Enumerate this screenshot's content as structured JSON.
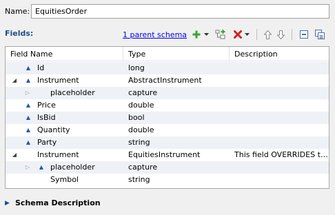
{
  "name_label": "Name:",
  "name_value": "EquitiesOrder",
  "fields_label": "Fields:",
  "toolbar": {
    "parent_schema_link": "1 parent schema",
    "icons": [
      "add-icon",
      "dropdown-arrow-icon",
      "add-child-icon",
      "delete-icon",
      "dropdown-arrow-icon",
      "move-up-icon",
      "move-down-icon",
      "collapse-all-icon",
      "expand-all-icon"
    ]
  },
  "columns": [
    "Field Name",
    "Type",
    "Description"
  ],
  "rows": [
    {
      "name": "Id",
      "type": "long",
      "description": "",
      "depth": 0,
      "twisty": "none",
      "icon": "attribute-icon"
    },
    {
      "name": "Instrument",
      "type": "AbstractInstrument",
      "description": "",
      "depth": 0,
      "twisty": "expanded",
      "icon": "attribute-icon"
    },
    {
      "name": "placeholder",
      "type": "capture",
      "description": "",
      "depth": 1,
      "twisty": "collapsed",
      "icon": "none"
    },
    {
      "name": "Price",
      "type": "double",
      "description": "",
      "depth": 0,
      "twisty": "none",
      "icon": "attribute-icon"
    },
    {
      "name": "IsBid",
      "type": "bool",
      "description": "",
      "depth": 0,
      "twisty": "none",
      "icon": "attribute-icon"
    },
    {
      "name": "Quantity",
      "type": "double",
      "description": "",
      "depth": 0,
      "twisty": "none",
      "icon": "attribute-icon"
    },
    {
      "name": "Party",
      "type": "string",
      "description": "",
      "depth": 0,
      "twisty": "none",
      "icon": "attribute-icon"
    },
    {
      "name": "Instrument",
      "type": "EquitiesInstrument",
      "description": "This field OVERRIDES th…",
      "depth": 0,
      "twisty": "expanded",
      "icon": "none"
    },
    {
      "name": "placeholder",
      "type": "capture",
      "description": "",
      "depth": 1,
      "twisty": "collapsed",
      "icon": "attribute-icon"
    },
    {
      "name": "Symbol",
      "type": "string",
      "description": "",
      "depth": 1,
      "twisty": "none",
      "icon": "none"
    }
  ],
  "schema_description_label": "Schema Description",
  "colors": {
    "fields_label": "#1e4e8c",
    "link": "#0000ee",
    "add_icon": "#3aa335",
    "delete_icon": "#d42020",
    "alt_row": "#eef1f6"
  }
}
